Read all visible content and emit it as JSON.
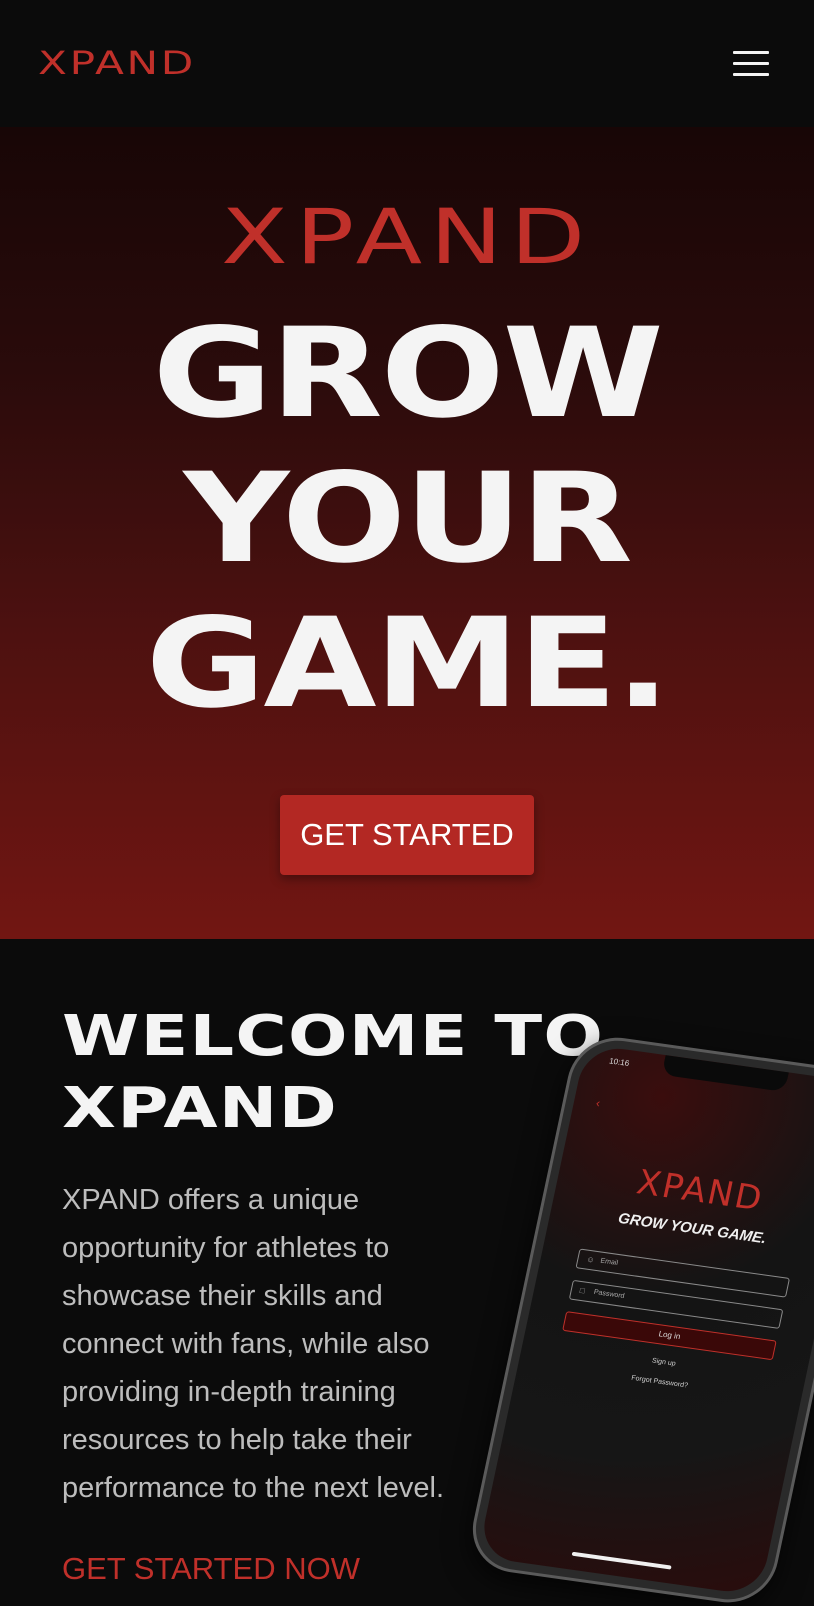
{
  "nav": {
    "logo": "XPAND",
    "menu_icon": "hamburger-menu-icon"
  },
  "hero": {
    "logo": "XPAND",
    "headline": [
      "GROW",
      "YOUR",
      "GAME."
    ],
    "cta_label": "GET STARTED"
  },
  "welcome": {
    "title": [
      "WELCOME TO",
      "XPAND"
    ],
    "body": "XPAND offers a unique opportunity for athletes to showcase their skills and connect with fans, while also providing in-depth training resources to help take their performance to the next level.",
    "link": "GET STARTED NOW"
  },
  "phone": {
    "time": "10:16",
    "logo": "XPAND",
    "tagline": "GROW YOUR GAME.",
    "email_placeholder": "Email",
    "password_placeholder": "Password",
    "login_label": "Log in",
    "signup_label": "Sign up",
    "forgot_label": "Forgot Password?"
  },
  "colors": {
    "brand_red": "#c0302a",
    "button_red": "#b32823",
    "background": "#0b0b0b",
    "text_light": "#f4f4f4",
    "text_muted": "#bdbdbd"
  }
}
